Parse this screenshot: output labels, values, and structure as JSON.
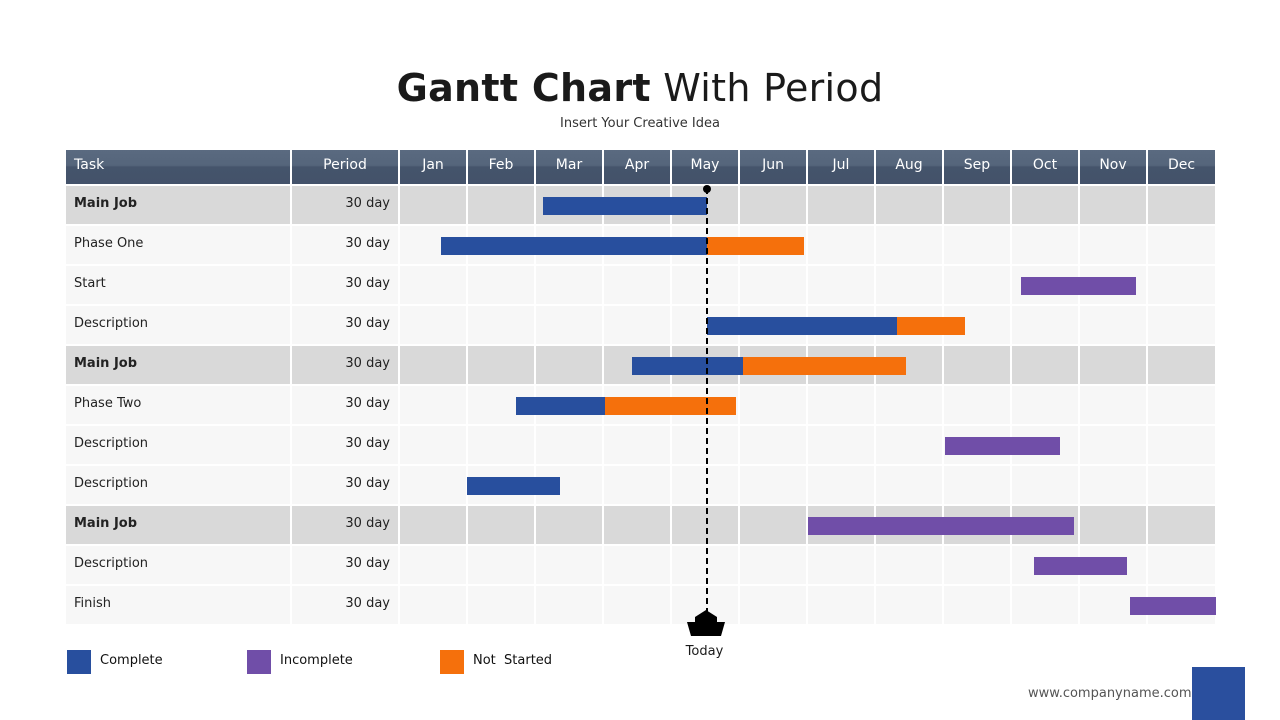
{
  "title_bold": "Gantt Chart",
  "title_light": "With Period",
  "subtitle": "Insert Your Creative Idea",
  "footer_url": "www.companyname.com",
  "colors": {
    "complete": "#284f9e",
    "incomplete": "#704ea8",
    "not_started": "#f5700c",
    "header": "#4a5a70",
    "row_main": "#d9d9d9",
    "row_sub": "#f7f7f7",
    "accent_box": "#2a4f9e"
  },
  "chart_data": {
    "type": "gantt",
    "title": "Gantt Chart With Period",
    "subtitle": "Insert Your Creative Idea",
    "columns": [
      "Task",
      "Period"
    ],
    "months": [
      "Jan",
      "Feb",
      "Mar",
      "Apr",
      "May",
      "Jun",
      "Jul",
      "Aug",
      "Sep",
      "Oct",
      "Nov",
      "Dec"
    ],
    "x_unit": "months from start of Jan",
    "xlim": [
      0,
      12
    ],
    "today": 4.51,
    "today_label": "Today",
    "legend": [
      {
        "key": "complete",
        "label": "Complete"
      },
      {
        "key": "incomplete",
        "label": "Incomplete"
      },
      {
        "key": "not_started",
        "label": "Not  Started"
      }
    ],
    "legend_position": "bottom-left",
    "tasks": [
      {
        "name": "Main Job",
        "period": "30 day",
        "main": true,
        "segments": [
          {
            "status": "complete",
            "start": 2.1,
            "end": 4.51
          }
        ]
      },
      {
        "name": "Phase One",
        "period": "30 day",
        "main": false,
        "segments": [
          {
            "status": "complete",
            "start": 0.6,
            "end": 4.51
          },
          {
            "status": "not_started",
            "start": 4.51,
            "end": 5.94
          }
        ]
      },
      {
        "name": "Start",
        "period": "30 day",
        "main": false,
        "segments": [
          {
            "status": "incomplete",
            "start": 9.13,
            "end": 10.82
          }
        ]
      },
      {
        "name": "Description",
        "period": "30 day",
        "main": false,
        "segments": [
          {
            "status": "complete",
            "start": 4.51,
            "end": 7.31
          },
          {
            "status": "not_started",
            "start": 7.31,
            "end": 8.31
          }
        ]
      },
      {
        "name": "Main Job",
        "period": "30 day",
        "main": true,
        "segments": [
          {
            "status": "complete",
            "start": 3.41,
            "end": 5.04
          },
          {
            "status": "not_started",
            "start": 5.04,
            "end": 7.44
          }
        ]
      },
      {
        "name": "Phase Two",
        "period": "30 day",
        "main": false,
        "segments": [
          {
            "status": "complete",
            "start": 1.71,
            "end": 3.01
          },
          {
            "status": "not_started",
            "start": 3.01,
            "end": 4.94
          }
        ]
      },
      {
        "name": "Description",
        "period": "30 day",
        "main": false,
        "segments": [
          {
            "status": "incomplete",
            "start": 8.01,
            "end": 9.71
          }
        ]
      },
      {
        "name": "Description",
        "period": "30 day",
        "main": false,
        "segments": [
          {
            "status": "complete",
            "start": 0.99,
            "end": 2.35
          }
        ]
      },
      {
        "name": "Main Job",
        "period": "30 day",
        "main": true,
        "segments": [
          {
            "status": "incomplete",
            "start": 6.0,
            "end": 9.91
          }
        ]
      },
      {
        "name": "Description",
        "period": "30 day",
        "main": false,
        "segments": [
          {
            "status": "incomplete",
            "start": 9.32,
            "end": 10.69
          }
        ]
      },
      {
        "name": "Finish",
        "period": "30 day",
        "main": false,
        "segments": [
          {
            "status": "incomplete",
            "start": 10.74,
            "end": 12.0
          }
        ]
      }
    ]
  }
}
